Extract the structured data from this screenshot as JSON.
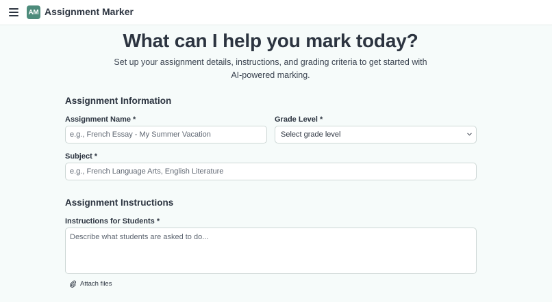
{
  "header": {
    "menu_icon": "hamburger-menu-icon",
    "logo_text": "AM",
    "app_title": "Assignment Marker"
  },
  "hero": {
    "title": "What can I help you mark today?",
    "subtitle": "Set up your assignment details, instructions, and grading criteria to get started with AI-powered marking."
  },
  "assignment_info": {
    "section_title": "Assignment Information",
    "name_label": "Assignment Name *",
    "name_placeholder": "e.g., French Essay - My Summer Vacation",
    "grade_label": "Grade Level *",
    "grade_selected": "Select grade level",
    "subject_label": "Subject *",
    "subject_placeholder": "e.g., French Language Arts, English Literature"
  },
  "instructions": {
    "section_title": "Assignment Instructions",
    "label": "Instructions for Students *",
    "placeholder": "Describe what students are asked to do...",
    "attach_label": "Attach files",
    "attach_icon": "paperclip-icon"
  },
  "colors": {
    "brand": "#4d8b7b",
    "background": "#f6fbfa",
    "text": "#2c3440"
  }
}
